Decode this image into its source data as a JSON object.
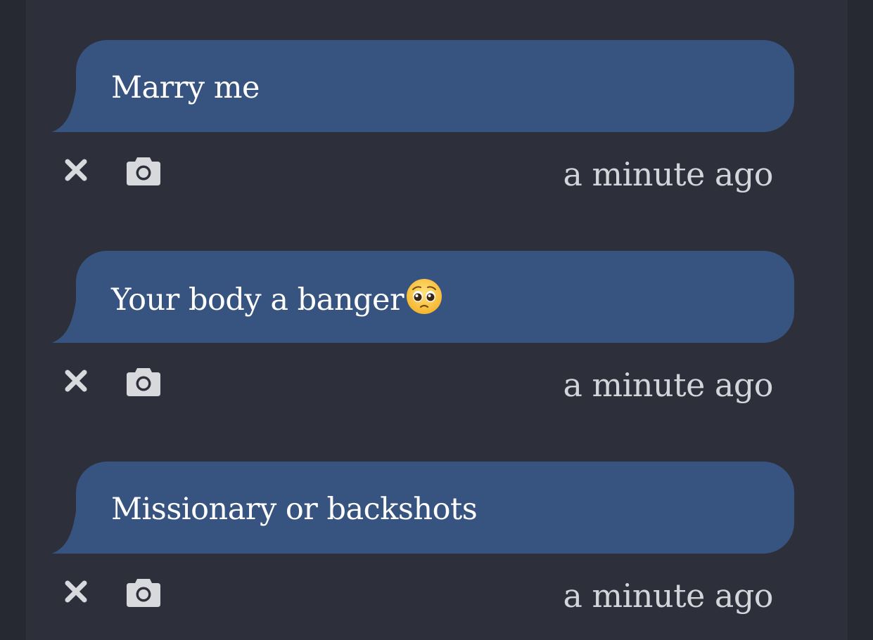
{
  "colors": {
    "page_background": "#262932",
    "panel_background": "#2d303b",
    "bubble_background": "#37537f",
    "bubble_text": "#ffffff",
    "timestamp_text": "#d3d5db",
    "icon_color": "#d8d9dd"
  },
  "messages": [
    {
      "text": "Marry me",
      "emoji": "",
      "timestamp": "a minute ago",
      "delete_icon": "close-icon",
      "screenshot_icon": "camera-icon"
    },
    {
      "text": "Your body a banger",
      "emoji": "pleading-face",
      "timestamp": "a minute ago",
      "delete_icon": "close-icon",
      "screenshot_icon": "camera-icon"
    },
    {
      "text": "Missionary or backshots",
      "emoji": "",
      "timestamp": "a minute ago",
      "delete_icon": "close-icon",
      "screenshot_icon": "camera-icon"
    }
  ]
}
